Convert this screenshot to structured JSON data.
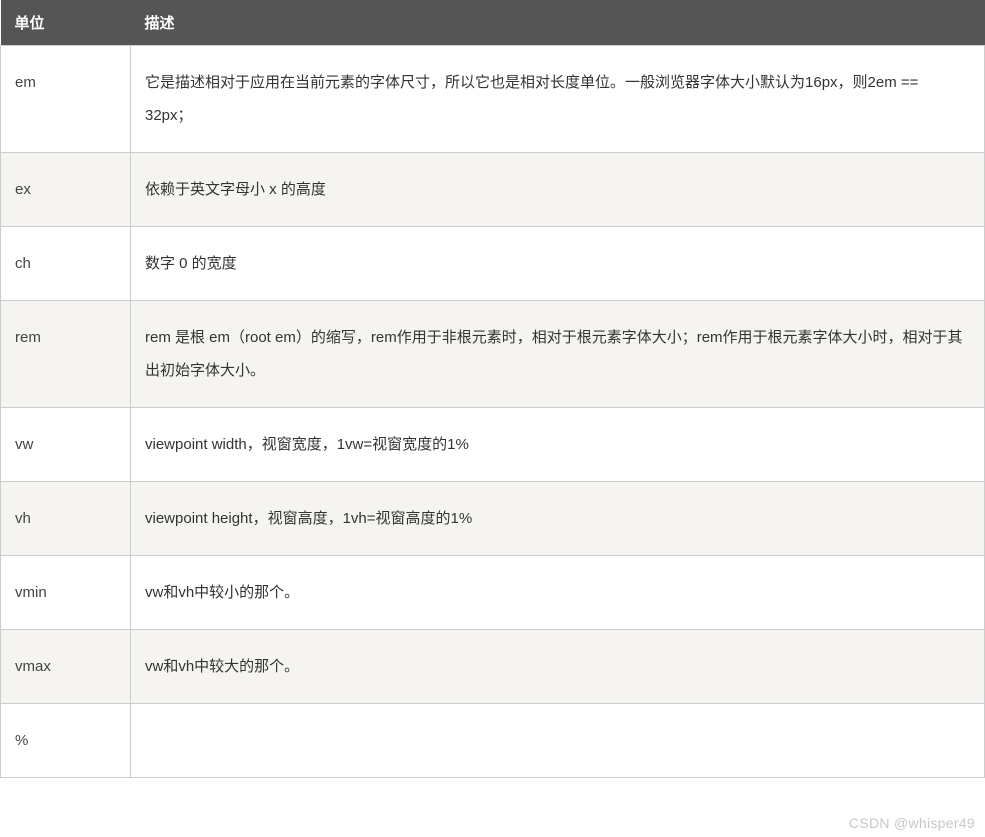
{
  "table": {
    "headers": {
      "unit": "单位",
      "description": "描述"
    },
    "rows": [
      {
        "unit": "em",
        "description": "它是描述相对于应用在当前元素的字体尺寸，所以它也是相对长度单位。一般浏览器字体大小默认为16px，则2em == 32px；"
      },
      {
        "unit": "ex",
        "description": "依赖于英文字母小 x 的高度"
      },
      {
        "unit": "ch",
        "description": "数字 0 的宽度"
      },
      {
        "unit": "rem",
        "description": "rem 是根 em（root em）的缩写，rem作用于非根元素时，相对于根元素字体大小；rem作用于根元素字体大小时，相对于其出初始字体大小。"
      },
      {
        "unit": "vw",
        "description": "viewpoint width，视窗宽度，1vw=视窗宽度的1%"
      },
      {
        "unit": "vh",
        "description": "viewpoint height，视窗高度，1vh=视窗高度的1%"
      },
      {
        "unit": "vmin",
        "description": "vw和vh中较小的那个。"
      },
      {
        "unit": "vmax",
        "description": "vw和vh中较大的那个。"
      },
      {
        "unit": "%",
        "description": ""
      }
    ]
  },
  "watermark": "CSDN @whisper49"
}
